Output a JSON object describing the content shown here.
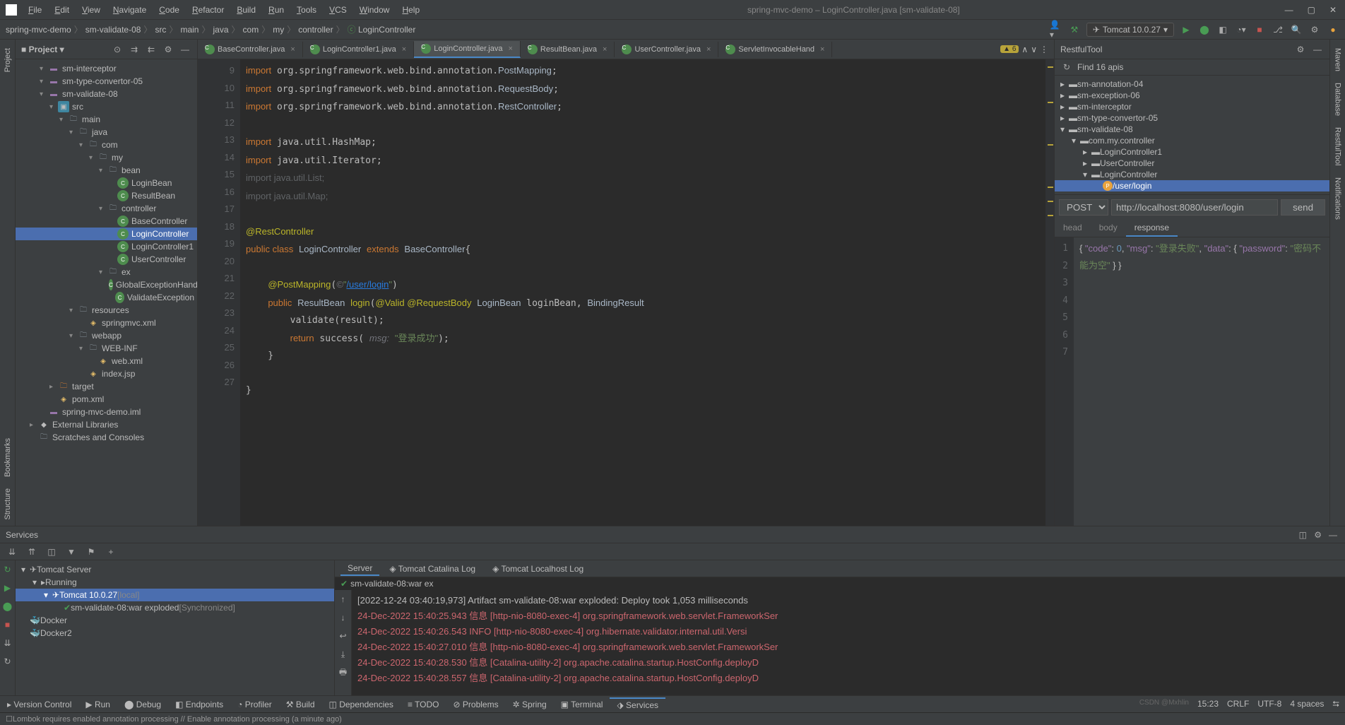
{
  "window": {
    "title": "spring-mvc-demo – LoginController.java [sm-validate-08]"
  },
  "menu": [
    "File",
    "Edit",
    "View",
    "Navigate",
    "Code",
    "Refactor",
    "Build",
    "Run",
    "Tools",
    "VCS",
    "Window",
    "Help"
  ],
  "breadcrumbs": [
    "spring-mvc-demo",
    "sm-validate-08",
    "src",
    "main",
    "java",
    "com",
    "my",
    "controller",
    "LoginController"
  ],
  "run_config": "Tomcat 10.0.27",
  "project_panel": {
    "title": "Project"
  },
  "project_tree": [
    {
      "depth": 0,
      "arrow": "▾",
      "icon": "module",
      "label": "sm-interceptor"
    },
    {
      "depth": 0,
      "arrow": "▾",
      "icon": "module",
      "label": "sm-type-convertor-05"
    },
    {
      "depth": 0,
      "arrow": "▾",
      "icon": "module",
      "label": "sm-validate-08"
    },
    {
      "depth": 1,
      "arrow": "▾",
      "icon": "src",
      "label": "src"
    },
    {
      "depth": 2,
      "arrow": "▾",
      "icon": "folder",
      "label": "main"
    },
    {
      "depth": 3,
      "arrow": "▾",
      "icon": "folder",
      "label": "java"
    },
    {
      "depth": 4,
      "arrow": "▾",
      "icon": "folder",
      "label": "com"
    },
    {
      "depth": 5,
      "arrow": "▾",
      "icon": "folder",
      "label": "my"
    },
    {
      "depth": 6,
      "arrow": "▾",
      "icon": "folder",
      "label": "bean"
    },
    {
      "depth": 7,
      "arrow": "",
      "icon": "class",
      "label": "LoginBean"
    },
    {
      "depth": 7,
      "arrow": "",
      "icon": "class",
      "label": "ResultBean"
    },
    {
      "depth": 6,
      "arrow": "▾",
      "icon": "folder",
      "label": "controller"
    },
    {
      "depth": 7,
      "arrow": "",
      "icon": "class",
      "label": "BaseController"
    },
    {
      "depth": 7,
      "arrow": "",
      "icon": "class",
      "label": "LoginController",
      "selected": true
    },
    {
      "depth": 7,
      "arrow": "",
      "icon": "class",
      "label": "LoginController1"
    },
    {
      "depth": 7,
      "arrow": "",
      "icon": "class",
      "label": "UserController"
    },
    {
      "depth": 6,
      "arrow": "▾",
      "icon": "folder",
      "label": "ex"
    },
    {
      "depth": 7,
      "arrow": "",
      "icon": "class",
      "label": "GlobalExceptionHandler"
    },
    {
      "depth": 7,
      "arrow": "",
      "icon": "class",
      "label": "ValidateException"
    },
    {
      "depth": 3,
      "arrow": "▾",
      "icon": "folder",
      "label": "resources"
    },
    {
      "depth": 4,
      "arrow": "",
      "icon": "xml",
      "label": "springmvc.xml"
    },
    {
      "depth": 3,
      "arrow": "▾",
      "icon": "folder",
      "label": "webapp"
    },
    {
      "depth": 4,
      "arrow": "▾",
      "icon": "folder",
      "label": "WEB-INF"
    },
    {
      "depth": 5,
      "arrow": "",
      "icon": "xml",
      "label": "web.xml"
    },
    {
      "depth": 4,
      "arrow": "",
      "icon": "xml",
      "label": "index.jsp"
    },
    {
      "depth": 1,
      "arrow": "▸",
      "icon": "target",
      "label": "target"
    },
    {
      "depth": 1,
      "arrow": "",
      "icon": "xml",
      "label": "pom.xml"
    },
    {
      "depth": 0,
      "arrow": "",
      "icon": "module",
      "label": "spring-mvc-demo.iml"
    },
    {
      "depth": -1,
      "arrow": "▸",
      "icon": "lib",
      "label": "External Libraries"
    },
    {
      "depth": -1,
      "arrow": "",
      "icon": "folder",
      "label": "Scratches and Consoles"
    }
  ],
  "editor_tabs": [
    {
      "label": "BaseController.java",
      "icon": "C"
    },
    {
      "label": "LoginController1.java",
      "icon": "C"
    },
    {
      "label": "LoginController.java",
      "icon": "C",
      "active": true
    },
    {
      "label": "ResultBean.java",
      "icon": "C"
    },
    {
      "label": "UserController.java",
      "icon": "C"
    },
    {
      "label": "ServletInvocableHand",
      "icon": "C"
    }
  ],
  "editor_warnings": "6",
  "code_lines": [
    9,
    10,
    11,
    12,
    13,
    14,
    15,
    16,
    17,
    18,
    19,
    20,
    21,
    22,
    23,
    24,
    25,
    26,
    27
  ],
  "restful": {
    "title": "RestfulTool",
    "found": "Find 16 apis",
    "tree": [
      {
        "depth": 0,
        "arrow": "▸",
        "icon": "module",
        "label": "sm-annotation-04"
      },
      {
        "depth": 0,
        "arrow": "▸",
        "icon": "module",
        "label": "sm-exception-06"
      },
      {
        "depth": 0,
        "arrow": "▸",
        "icon": "module",
        "label": "sm-interceptor"
      },
      {
        "depth": 0,
        "arrow": "▸",
        "icon": "module",
        "label": "sm-type-convertor-05"
      },
      {
        "depth": 0,
        "arrow": "▾",
        "icon": "module",
        "label": "sm-validate-08"
      },
      {
        "depth": 1,
        "arrow": "▾",
        "icon": "folder",
        "label": "com.my.controller"
      },
      {
        "depth": 2,
        "arrow": "▸",
        "icon": "class",
        "label": "LoginController1"
      },
      {
        "depth": 2,
        "arrow": "▸",
        "icon": "class",
        "label": "UserController"
      },
      {
        "depth": 2,
        "arrow": "▾",
        "icon": "class",
        "label": "LoginController"
      },
      {
        "depth": 3,
        "arrow": "",
        "icon": "post",
        "label": "/user/login",
        "selected": true
      }
    ],
    "method": "POST",
    "url": "http://localhost:8080/user/login",
    "send": "send",
    "resp_tabs": [
      "head",
      "body",
      "response"
    ],
    "resp_active": "response",
    "response_json": {
      "code": 0,
      "msg": "登录失败",
      "data_key": "data",
      "password_key": "password",
      "password_val": "密码不能为空"
    }
  },
  "services": {
    "title": "Services",
    "tree": [
      {
        "depth": 0,
        "arrow": "▾",
        "icon": "tomcat",
        "label": "Tomcat Server"
      },
      {
        "depth": 1,
        "arrow": "▾",
        "icon": "run",
        "label": "Running"
      },
      {
        "depth": 2,
        "arrow": "▾",
        "icon": "tomcat",
        "label": "Tomcat 10.0.27",
        "extra": "[local]",
        "selected": true
      },
      {
        "depth": 3,
        "arrow": "",
        "icon": "ok",
        "label": "sm-validate-08:war exploded",
        "extra": "[Synchronized]"
      },
      {
        "depth": 0,
        "arrow": "",
        "icon": "docker",
        "label": "Docker"
      },
      {
        "depth": 0,
        "arrow": "",
        "icon": "docker",
        "label": "Docker2"
      }
    ],
    "log_tabs": [
      "Server",
      "Tomcat Catalina Log",
      "Tomcat Localhost Log"
    ],
    "artifact_status": "sm-validate-08:war ex",
    "console": [
      {
        "cls": "ts",
        "text": "[2022-12-24 03:40:19,973] Artifact sm-validate-08:war exploded: Deploy took 1,053 milliseconds"
      },
      {
        "cls": "err",
        "text": "24-Dec-2022 15:40:25.943 信息 [http-nio-8080-exec-4] org.springframework.web.servlet.FrameworkSer"
      },
      {
        "cls": "err",
        "text": "24-Dec-2022 15:40:26.543 INFO [http-nio-8080-exec-4] org.hibernate.validator.internal.util.Versi"
      },
      {
        "cls": "err",
        "text": "24-Dec-2022 15:40:27.010 信息 [http-nio-8080-exec-4] org.springframework.web.servlet.FrameworkSer"
      },
      {
        "cls": "err",
        "text": "24-Dec-2022 15:40:28.530 信息 [Catalina-utility-2] org.apache.catalina.startup.HostConfig.deployD"
      },
      {
        "cls": "err",
        "text": "24-Dec-2022 15:40:28.557 信息 [Catalina-utility-2] org.apache.catalina.startup.HostConfig.deployD"
      }
    ]
  },
  "status_tabs": [
    {
      "icon": "▸",
      "label": "Version Control"
    },
    {
      "icon": "▶",
      "label": "Run"
    },
    {
      "icon": "⬤",
      "label": "Debug"
    },
    {
      "icon": "◧",
      "label": "Endpoints"
    },
    {
      "icon": "◔",
      "label": "Profiler"
    },
    {
      "icon": "⚒",
      "label": "Build"
    },
    {
      "icon": "◫",
      "label": "Dependencies"
    },
    {
      "icon": "≡",
      "label": "TODO"
    },
    {
      "icon": "⊘",
      "label": "Problems"
    },
    {
      "icon": "✲",
      "label": "Spring"
    },
    {
      "icon": "▣",
      "label": "Terminal"
    },
    {
      "icon": "⬗",
      "label": "Services",
      "active": true
    }
  ],
  "status_right": [
    "15:23",
    "CRLF",
    "UTF-8",
    "4 spaces",
    "⮀"
  ],
  "notification": "Lombok requires enabled annotation processing // Enable annotation processing (a minute ago)",
  "watermark": "CSDN @Mxhlin"
}
